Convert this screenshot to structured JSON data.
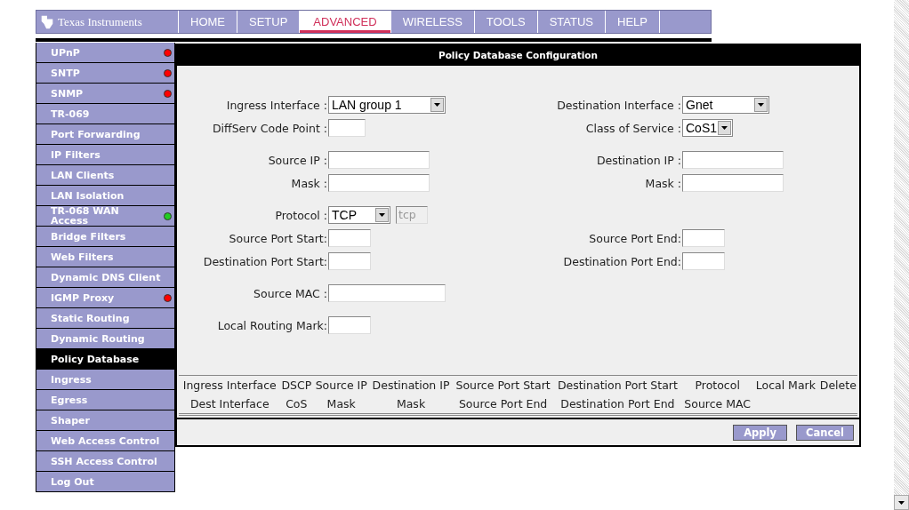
{
  "header": {
    "logo": "Texas Instruments",
    "tabs": [
      {
        "label": "HOME",
        "selected": false
      },
      {
        "label": "SETUP",
        "selected": false
      },
      {
        "label": "ADVANCED",
        "selected": true
      },
      {
        "label": "WIRELESS",
        "selected": false
      },
      {
        "label": "TOOLS",
        "selected": false
      },
      {
        "label": "STATUS",
        "selected": false
      },
      {
        "label": "HELP",
        "selected": false
      }
    ]
  },
  "sidebar": {
    "items": [
      {
        "label": "UPnP",
        "selected": false,
        "color": "#ff0000"
      },
      {
        "label": "SNTP",
        "selected": false,
        "color": "#ff0000"
      },
      {
        "label": "SNMP",
        "selected": false,
        "color": "#ff0000"
      },
      {
        "label": "TR-069",
        "selected": false
      },
      {
        "label": "Port Forwarding",
        "selected": false
      },
      {
        "label": "IP Filters",
        "selected": false
      },
      {
        "label": "LAN Clients",
        "selected": false
      },
      {
        "label": "LAN Isolation",
        "selected": false
      },
      {
        "label": "TR-068 WAN Access",
        "selected": false,
        "color": "#22cc22"
      },
      {
        "label": "Bridge Filters",
        "selected": false
      },
      {
        "label": "Web Filters",
        "selected": false
      },
      {
        "label": "Dynamic DNS Client",
        "selected": false
      },
      {
        "label": "IGMP Proxy",
        "selected": false,
        "color": "#ff0000"
      },
      {
        "label": "Static Routing",
        "selected": false
      },
      {
        "label": "Dynamic Routing",
        "selected": false
      },
      {
        "label": "Policy Database",
        "selected": true
      },
      {
        "label": "Ingress",
        "selected": false
      },
      {
        "label": "Egress",
        "selected": false
      },
      {
        "label": "Shaper",
        "selected": false
      },
      {
        "label": "Web Access Control",
        "selected": false
      },
      {
        "label": "SSH Access Control",
        "selected": false
      },
      {
        "label": "Log Out",
        "selected": false
      }
    ]
  },
  "panel": {
    "title": "Policy Database Configuration",
    "sections": [
      [
        {
          "left": {
            "label": "Ingress Interface :",
            "kind": "select",
            "value": "LAN group 1"
          },
          "right": {
            "label": "Destination Interface :",
            "kind": "select",
            "value": "Gnet"
          }
        },
        {
          "left": {
            "label": "DiffServ Code Point :",
            "kind": "text"
          },
          "right": {
            "label": "Class of Service :",
            "kind": "select",
            "value": "CoS1"
          }
        }
      ],
      [
        {
          "left": {
            "label": "Source IP :",
            "kind": "text"
          },
          "right": {
            "label": "Destination IP :",
            "kind": "text"
          }
        },
        {
          "left": {
            "label": "Mask :",
            "kind": "text"
          },
          "right": {
            "label": "Mask :",
            "kind": "text"
          }
        }
      ],
      [
        {
          "left": {
            "label": "Protocol :",
            "kind": "select",
            "value": "TCP",
            "extra": {
              "value": "tcp",
              "disabled": true
            }
          }
        },
        {
          "left": {
            "label": "Source Port Start:",
            "kind": "text"
          },
          "right": {
            "label": "Source Port End:",
            "kind": "text"
          }
        },
        {
          "left": {
            "label": "Destination Port Start:",
            "kind": "text"
          },
          "right": {
            "label": "Destination Port End:",
            "kind": "text"
          }
        }
      ],
      [
        {
          "left": {
            "label": "Source MAC :",
            "kind": "text"
          }
        }
      ],
      [
        {
          "left": {
            "label": "Local Routing Mark:",
            "kind": "text"
          }
        }
      ]
    ],
    "table": {
      "header_rows": [
        [
          "Ingress Interface",
          "DSCP",
          "Source IP",
          "Destination IP",
          "Source Port Start",
          "Destination Port Start",
          "Protocol",
          "Local Mark",
          "Delete"
        ],
        [
          "Dest Interface",
          "CoS",
          "Mask",
          "Mask",
          "Source Port End",
          "Destination Port End",
          "Source MAC"
        ]
      ]
    },
    "buttons": [
      "Apply",
      "Cancel"
    ]
  }
}
